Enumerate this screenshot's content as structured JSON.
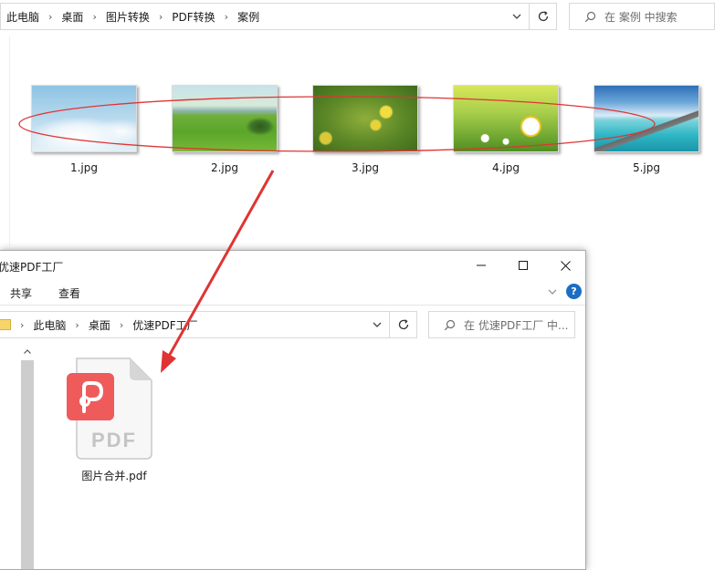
{
  "back_window": {
    "breadcrumb": [
      "此电脑",
      "桌面",
      "图片转换",
      "PDF转换",
      "案例"
    ],
    "search_placeholder": "在 案例 中搜索",
    "files": [
      {
        "name": "1.jpg"
      },
      {
        "name": "2.jpg"
      },
      {
        "name": "3.jpg"
      },
      {
        "name": "4.jpg"
      },
      {
        "name": "5.jpg"
      }
    ]
  },
  "front_window": {
    "title": "优速PDF工厂",
    "ribbon_tabs": [
      "共享",
      "查看"
    ],
    "breadcrumb": [
      "此电脑",
      "桌面",
      "优速PDF工厂"
    ],
    "search_placeholder": "在 优速PDF工厂 中...",
    "file": {
      "name": "图片合并.pdf",
      "icon_text": "PDF"
    }
  },
  "colors": {
    "annotation_red": "#e03434",
    "pdf_brand_red": "#ef5b5b",
    "help_blue": "#1b6ec2"
  },
  "icons": [
    "chevron-right-icon",
    "chevron-down-icon",
    "refresh-icon",
    "search-icon",
    "minimize-icon",
    "maximize-icon",
    "close-icon",
    "help-icon",
    "folder-icon",
    "scroll-up-icon",
    "pdf-file-icon"
  ]
}
